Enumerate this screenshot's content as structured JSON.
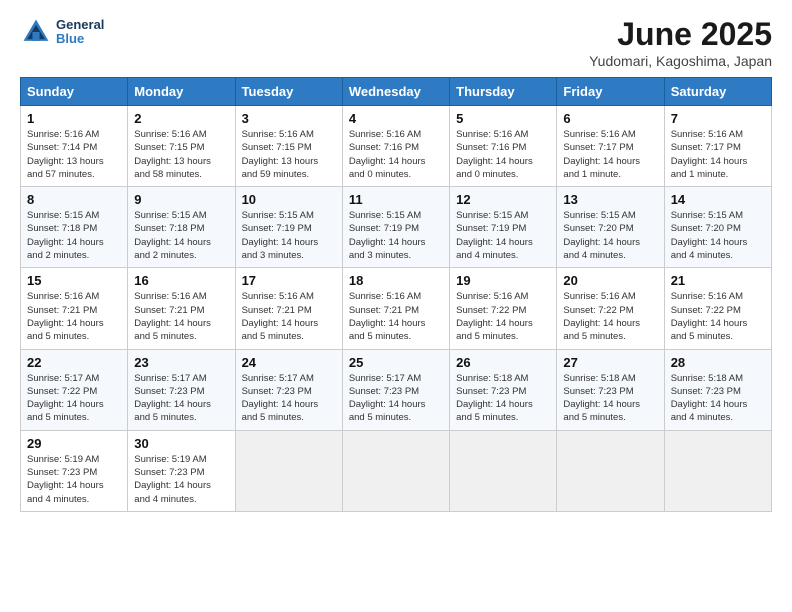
{
  "header": {
    "logo_line1": "General",
    "logo_line2": "Blue",
    "title": "June 2025",
    "subtitle": "Yudomari, Kagoshima, Japan"
  },
  "days_of_week": [
    "Sunday",
    "Monday",
    "Tuesday",
    "Wednesday",
    "Thursday",
    "Friday",
    "Saturday"
  ],
  "weeks": [
    [
      {
        "day": 1,
        "lines": [
          "Sunrise: 5:16 AM",
          "Sunset: 7:14 PM",
          "Daylight: 13 hours",
          "and 57 minutes."
        ]
      },
      {
        "day": 2,
        "lines": [
          "Sunrise: 5:16 AM",
          "Sunset: 7:15 PM",
          "Daylight: 13 hours",
          "and 58 minutes."
        ]
      },
      {
        "day": 3,
        "lines": [
          "Sunrise: 5:16 AM",
          "Sunset: 7:15 PM",
          "Daylight: 13 hours",
          "and 59 minutes."
        ]
      },
      {
        "day": 4,
        "lines": [
          "Sunrise: 5:16 AM",
          "Sunset: 7:16 PM",
          "Daylight: 14 hours",
          "and 0 minutes."
        ]
      },
      {
        "day": 5,
        "lines": [
          "Sunrise: 5:16 AM",
          "Sunset: 7:16 PM",
          "Daylight: 14 hours",
          "and 0 minutes."
        ]
      },
      {
        "day": 6,
        "lines": [
          "Sunrise: 5:16 AM",
          "Sunset: 7:17 PM",
          "Daylight: 14 hours",
          "and 1 minute."
        ]
      },
      {
        "day": 7,
        "lines": [
          "Sunrise: 5:16 AM",
          "Sunset: 7:17 PM",
          "Daylight: 14 hours",
          "and 1 minute."
        ]
      }
    ],
    [
      {
        "day": 8,
        "lines": [
          "Sunrise: 5:15 AM",
          "Sunset: 7:18 PM",
          "Daylight: 14 hours",
          "and 2 minutes."
        ]
      },
      {
        "day": 9,
        "lines": [
          "Sunrise: 5:15 AM",
          "Sunset: 7:18 PM",
          "Daylight: 14 hours",
          "and 2 minutes."
        ]
      },
      {
        "day": 10,
        "lines": [
          "Sunrise: 5:15 AM",
          "Sunset: 7:19 PM",
          "Daylight: 14 hours",
          "and 3 minutes."
        ]
      },
      {
        "day": 11,
        "lines": [
          "Sunrise: 5:15 AM",
          "Sunset: 7:19 PM",
          "Daylight: 14 hours",
          "and 3 minutes."
        ]
      },
      {
        "day": 12,
        "lines": [
          "Sunrise: 5:15 AM",
          "Sunset: 7:19 PM",
          "Daylight: 14 hours",
          "and 4 minutes."
        ]
      },
      {
        "day": 13,
        "lines": [
          "Sunrise: 5:15 AM",
          "Sunset: 7:20 PM",
          "Daylight: 14 hours",
          "and 4 minutes."
        ]
      },
      {
        "day": 14,
        "lines": [
          "Sunrise: 5:15 AM",
          "Sunset: 7:20 PM",
          "Daylight: 14 hours",
          "and 4 minutes."
        ]
      }
    ],
    [
      {
        "day": 15,
        "lines": [
          "Sunrise: 5:16 AM",
          "Sunset: 7:21 PM",
          "Daylight: 14 hours",
          "and 5 minutes."
        ]
      },
      {
        "day": 16,
        "lines": [
          "Sunrise: 5:16 AM",
          "Sunset: 7:21 PM",
          "Daylight: 14 hours",
          "and 5 minutes."
        ]
      },
      {
        "day": 17,
        "lines": [
          "Sunrise: 5:16 AM",
          "Sunset: 7:21 PM",
          "Daylight: 14 hours",
          "and 5 minutes."
        ]
      },
      {
        "day": 18,
        "lines": [
          "Sunrise: 5:16 AM",
          "Sunset: 7:21 PM",
          "Daylight: 14 hours",
          "and 5 minutes."
        ]
      },
      {
        "day": 19,
        "lines": [
          "Sunrise: 5:16 AM",
          "Sunset: 7:22 PM",
          "Daylight: 14 hours",
          "and 5 minutes."
        ]
      },
      {
        "day": 20,
        "lines": [
          "Sunrise: 5:16 AM",
          "Sunset: 7:22 PM",
          "Daylight: 14 hours",
          "and 5 minutes."
        ]
      },
      {
        "day": 21,
        "lines": [
          "Sunrise: 5:16 AM",
          "Sunset: 7:22 PM",
          "Daylight: 14 hours",
          "and 5 minutes."
        ]
      }
    ],
    [
      {
        "day": 22,
        "lines": [
          "Sunrise: 5:17 AM",
          "Sunset: 7:22 PM",
          "Daylight: 14 hours",
          "and 5 minutes."
        ]
      },
      {
        "day": 23,
        "lines": [
          "Sunrise: 5:17 AM",
          "Sunset: 7:23 PM",
          "Daylight: 14 hours",
          "and 5 minutes."
        ]
      },
      {
        "day": 24,
        "lines": [
          "Sunrise: 5:17 AM",
          "Sunset: 7:23 PM",
          "Daylight: 14 hours",
          "and 5 minutes."
        ]
      },
      {
        "day": 25,
        "lines": [
          "Sunrise: 5:17 AM",
          "Sunset: 7:23 PM",
          "Daylight: 14 hours",
          "and 5 minutes."
        ]
      },
      {
        "day": 26,
        "lines": [
          "Sunrise: 5:18 AM",
          "Sunset: 7:23 PM",
          "Daylight: 14 hours",
          "and 5 minutes."
        ]
      },
      {
        "day": 27,
        "lines": [
          "Sunrise: 5:18 AM",
          "Sunset: 7:23 PM",
          "Daylight: 14 hours",
          "and 5 minutes."
        ]
      },
      {
        "day": 28,
        "lines": [
          "Sunrise: 5:18 AM",
          "Sunset: 7:23 PM",
          "Daylight: 14 hours",
          "and 4 minutes."
        ]
      }
    ],
    [
      {
        "day": 29,
        "lines": [
          "Sunrise: 5:19 AM",
          "Sunset: 7:23 PM",
          "Daylight: 14 hours",
          "and 4 minutes."
        ]
      },
      {
        "day": 30,
        "lines": [
          "Sunrise: 5:19 AM",
          "Sunset: 7:23 PM",
          "Daylight: 14 hours",
          "and 4 minutes."
        ]
      },
      null,
      null,
      null,
      null,
      null
    ]
  ]
}
